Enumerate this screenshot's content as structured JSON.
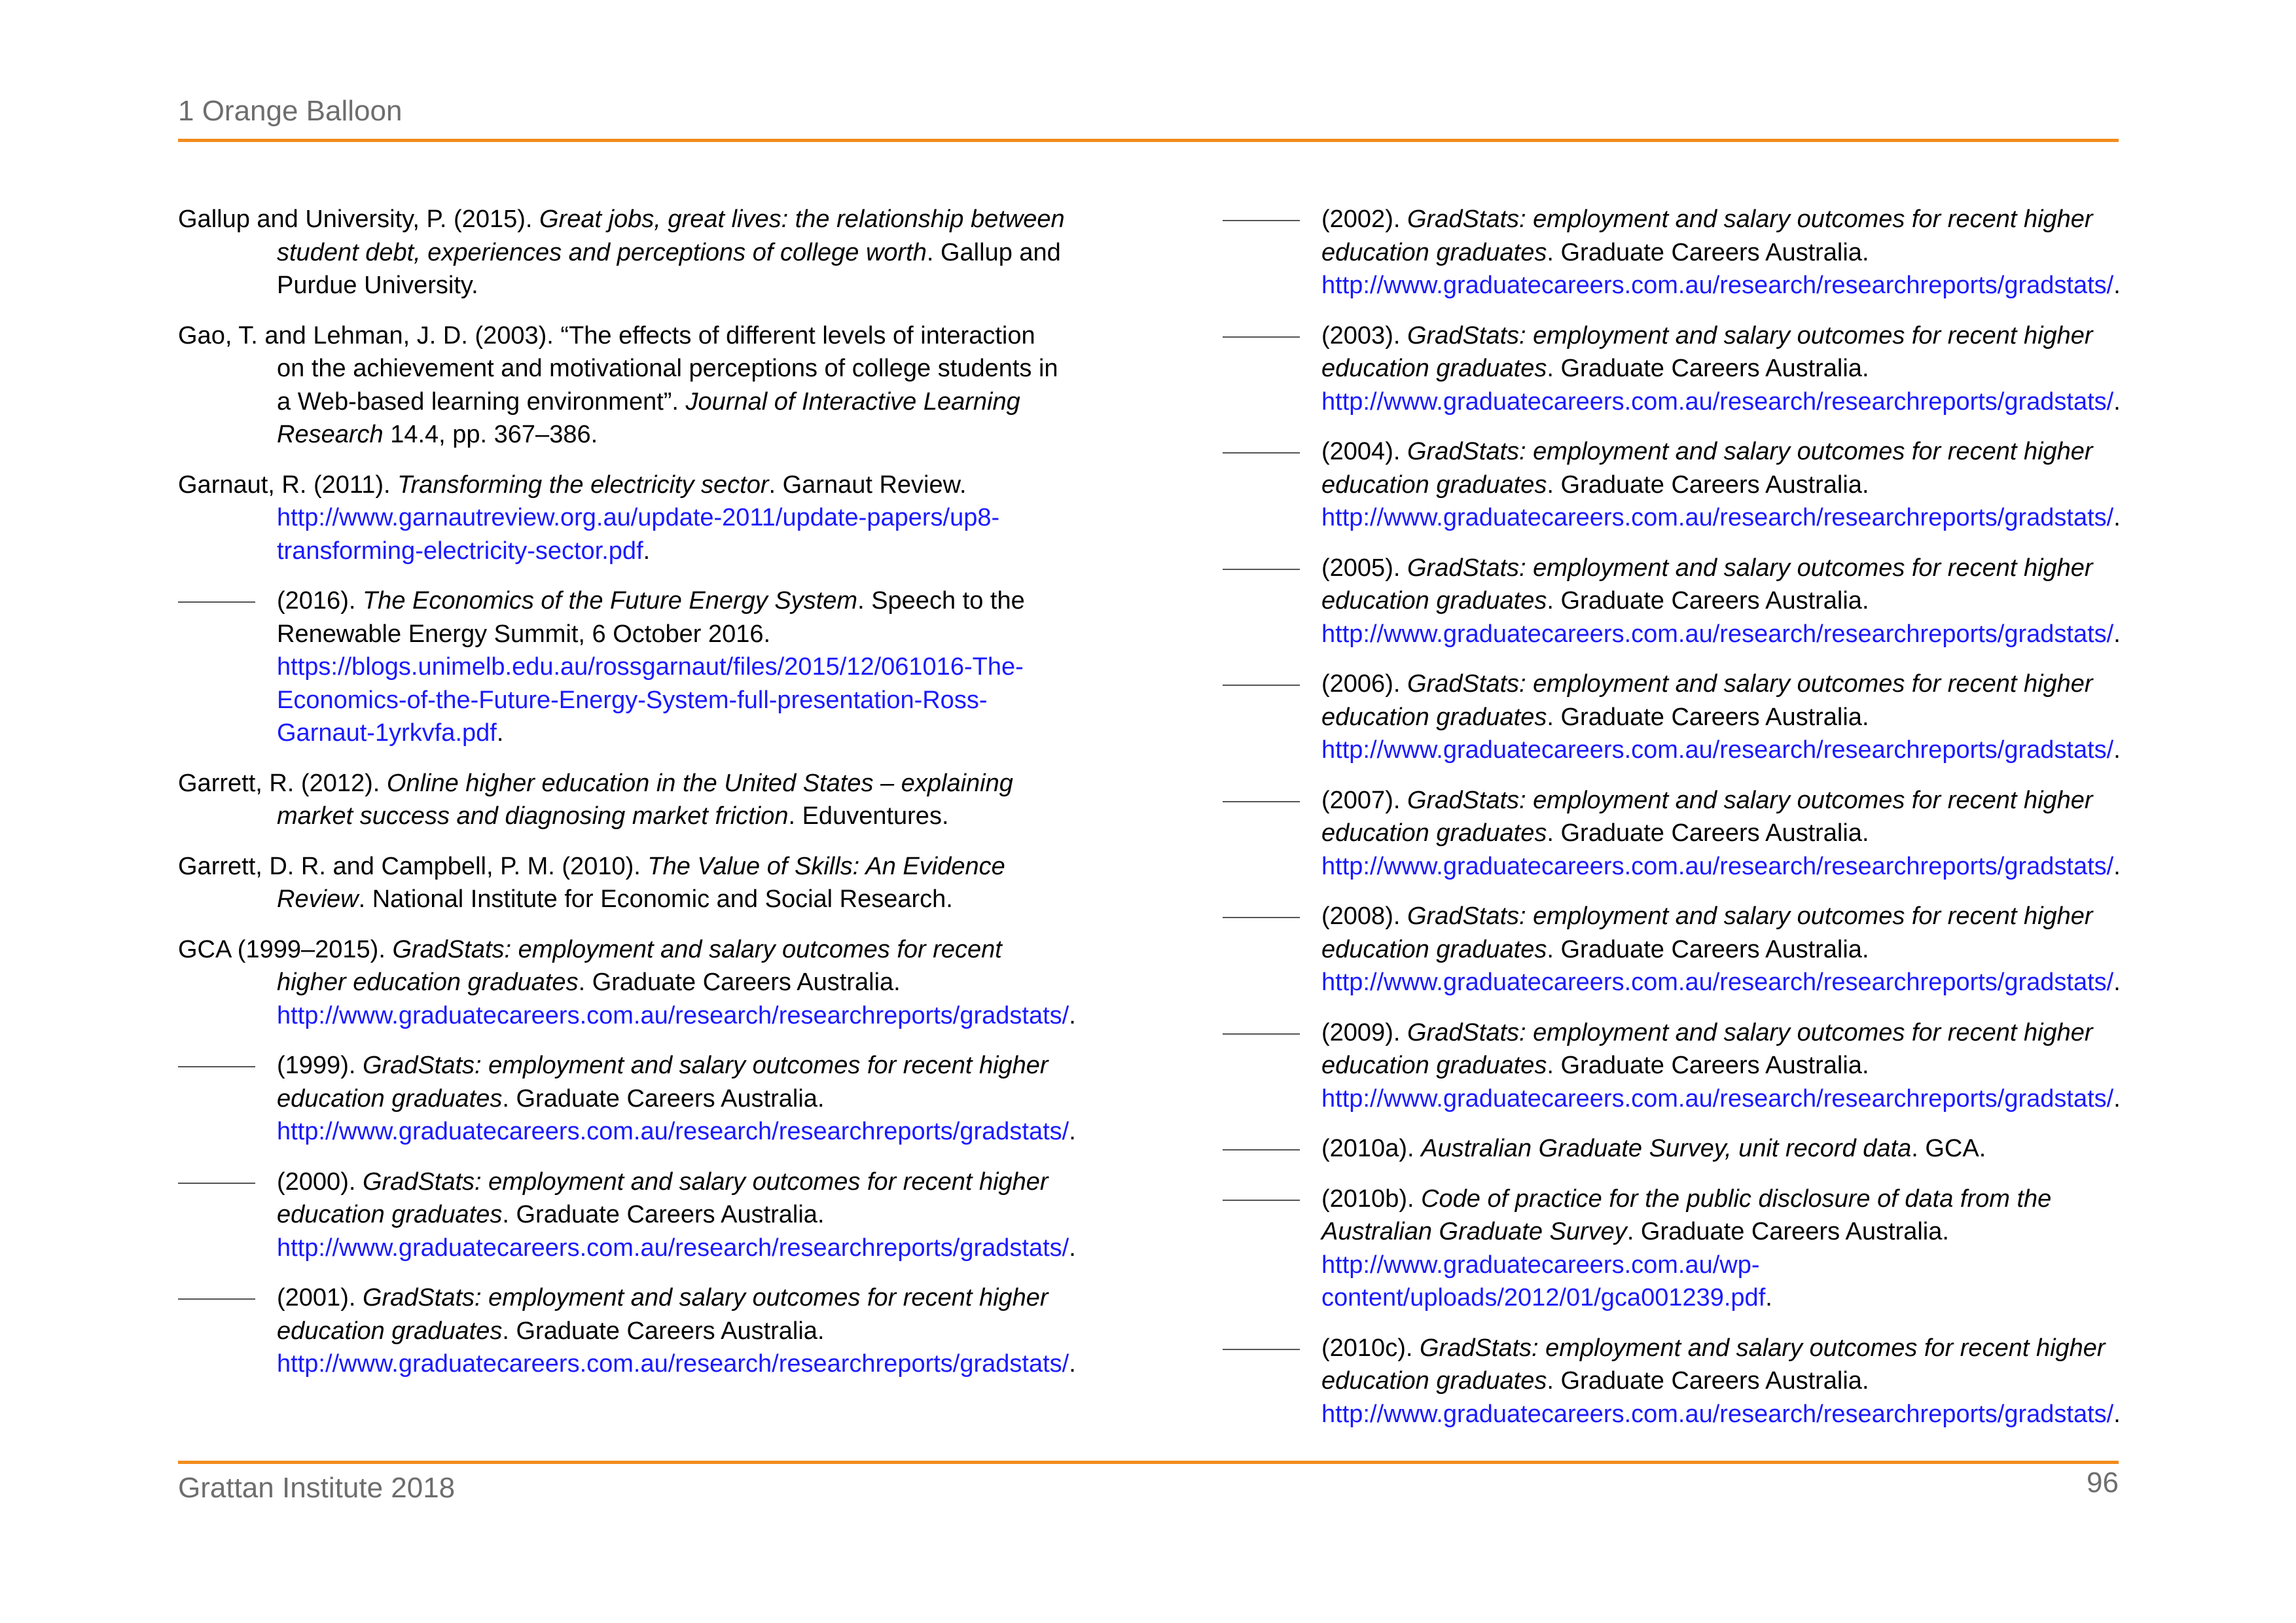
{
  "header": {
    "title": "1 Orange Balloon"
  },
  "footer": {
    "left": "Grattan Institute 2018",
    "page_number": "96"
  },
  "colors": {
    "accent_rule": "#f28c1c",
    "link": "#1a1aff",
    "muted_text": "#6e6e6e"
  },
  "references": {
    "left": [
      {
        "lead": "Gallup and University, P. (2015). ",
        "title": "Great jobs, great lives: the relationship between student debt, experiences and perceptions of college worth",
        "after_title": ". Gallup and Purdue University.",
        "link": "",
        "end": ""
      },
      {
        "lead": "Gao, T. and Lehman, J. D. (2003). “The effects of different levels of interaction on the achievement and motivational perceptions of college students in a Web-based learning environment”. ",
        "title": "Journal of Interactive Learning Research",
        "after_title": " 14.4, pp. 367–386.",
        "link": "",
        "end": ""
      },
      {
        "lead": "Garnaut, R. (2011). ",
        "title": "Transforming the electricity sector",
        "after_title": ". Garnaut Review. ",
        "link": "http://www.garnautreview.org.au/update-2011/update-papers/up8-transforming-electricity-sector.pdf",
        "end": "."
      },
      {
        "lead": "(2016). ",
        "title": "The Economics of the Future Energy System",
        "after_title": ". Speech to the Renewable Energy Summit, 6 October 2016. ",
        "link": "https://blogs.unimelb.edu.au/rossgarnaut/files/2015/12/061016-The-Economics-of-the-Future-Energy-System-full-presentation-Ross-Garnaut-1yrkvfa.pdf",
        "end": "."
      },
      {
        "lead": "Garrett, R. (2012). ",
        "title": "Online higher education in the United States – explaining market success and diagnosing market friction",
        "after_title": ". Eduventures.",
        "link": "",
        "end": ""
      },
      {
        "lead": "Garrett, D. R. and Campbell, P. M. (2010). ",
        "title": "The Value of Skills: An Evidence Review",
        "after_title": ". National Institute for Economic and Social Research.",
        "link": "",
        "end": ""
      },
      {
        "lead": "GCA (1999–2015). ",
        "title": "GradStats: employment and salary outcomes for recent higher education graduates",
        "after_title": ". Graduate Careers Australia. ",
        "link": "http://www.graduatecareers.com.au/research/researchreports/gradstats/",
        "end": "."
      },
      {
        "lead": "(1999). ",
        "title": "GradStats: employment and salary outcomes for recent higher education graduates",
        "after_title": ". Graduate Careers Australia. ",
        "link": "http://www.graduatecareers.com.au/research/researchreports/gradstats/",
        "end": "."
      },
      {
        "lead": "(2000). ",
        "title": "GradStats: employment and salary outcomes for recent higher education graduates",
        "after_title": ". Graduate Careers Australia. ",
        "link": "http://www.graduatecareers.com.au/research/researchreports/gradstats/",
        "end": "."
      },
      {
        "lead": "(2001). ",
        "title": "GradStats: employment and salary outcomes for recent higher education graduates",
        "after_title": ". Graduate Careers Australia. ",
        "link": "http://www.graduatecareers.com.au/research/researchreports/gradstats/",
        "end": "."
      }
    ],
    "right": [
      {
        "lead": "(2002). ",
        "title": "GradStats: employment and salary outcomes for recent higher education graduates",
        "after_title": ". Graduate Careers Australia. ",
        "link": "http://www.graduatecareers.com.au/research/researchreports/gradstats/",
        "end": "."
      },
      {
        "lead": "(2003). ",
        "title": "GradStats: employment and salary outcomes for recent higher education graduates",
        "after_title": ". Graduate Careers Australia. ",
        "link": "http://www.graduatecareers.com.au/research/researchreports/gradstats/",
        "end": "."
      },
      {
        "lead": "(2004). ",
        "title": "GradStats: employment and salary outcomes for recent higher education graduates",
        "after_title": ". Graduate Careers Australia. ",
        "link": "http://www.graduatecareers.com.au/research/researchreports/gradstats/",
        "end": "."
      },
      {
        "lead": "(2005). ",
        "title": "GradStats: employment and salary outcomes for recent higher education graduates",
        "after_title": ". Graduate Careers Australia. ",
        "link": "http://www.graduatecareers.com.au/research/researchreports/gradstats/",
        "end": "."
      },
      {
        "lead": "(2006). ",
        "title": "GradStats: employment and salary outcomes for recent higher education graduates",
        "after_title": ". Graduate Careers Australia. ",
        "link": "http://www.graduatecareers.com.au/research/researchreports/gradstats/",
        "end": "."
      },
      {
        "lead": "(2007). ",
        "title": "GradStats: employment and salary outcomes for recent higher education graduates",
        "after_title": ". Graduate Careers Australia. ",
        "link": "http://www.graduatecareers.com.au/research/researchreports/gradstats/",
        "end": "."
      },
      {
        "lead": "(2008). ",
        "title": "GradStats: employment and salary outcomes for recent higher education graduates",
        "after_title": ". Graduate Careers Australia. ",
        "link": "http://www.graduatecareers.com.au/research/researchreports/gradstats/",
        "end": "."
      },
      {
        "lead": "(2009). ",
        "title": "GradStats: employment and salary outcomes for recent higher education graduates",
        "after_title": ". Graduate Careers Australia. ",
        "link": "http://www.graduatecareers.com.au/research/researchreports/gradstats/",
        "end": "."
      },
      {
        "lead": "(2010a). ",
        "title": "Australian Graduate Survey, unit record data",
        "after_title": ". GCA.",
        "link": "",
        "end": ""
      },
      {
        "lead": "(2010b). ",
        "title": "Code of practice for the public disclosure of data from the Australian Graduate Survey",
        "after_title": ". Graduate Careers Australia. ",
        "link": "http://www.graduatecareers.com.au/wp-content/uploads/2012/01/gca001239.pdf",
        "end": "."
      },
      {
        "lead": "(2010c). ",
        "title": "GradStats: employment and salary outcomes for recent higher education graduates",
        "after_title": ". Graduate Careers Australia. ",
        "link": "http://www.graduatecareers.com.au/research/researchreports/gradstats/",
        "end": "."
      }
    ]
  }
}
